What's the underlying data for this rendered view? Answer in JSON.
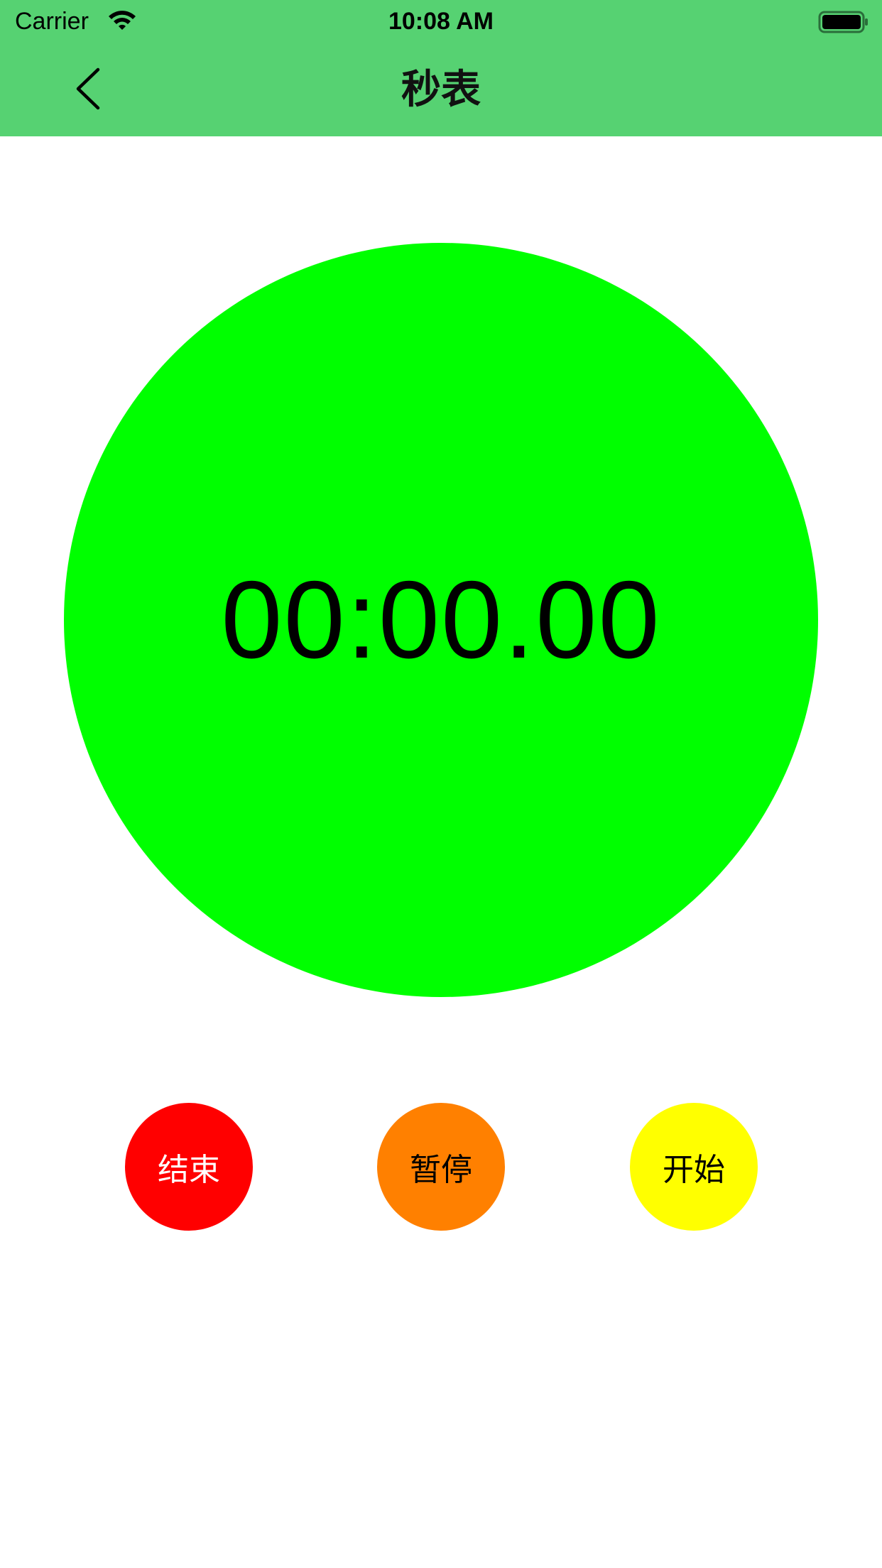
{
  "status_bar": {
    "carrier": "Carrier",
    "time": "10:08 AM",
    "wifi_icon": "wifi-icon",
    "battery_icon": "battery-full-icon"
  },
  "nav": {
    "title": "秒表",
    "back_icon": "chevron-left-icon"
  },
  "timer": {
    "display": "00:00.00",
    "circle_color": "#00ff00"
  },
  "buttons": {
    "stop": {
      "label": "结束",
      "color": "#ff0000",
      "text_color": "#ffffff"
    },
    "pause": {
      "label": "暂停",
      "color": "#ff8000",
      "text_color": "#000000"
    },
    "start": {
      "label": "开始",
      "color": "#ffff00",
      "text_color": "#000000"
    }
  },
  "colors": {
    "header_background": "#56d272",
    "page_background": "#ffffff"
  }
}
